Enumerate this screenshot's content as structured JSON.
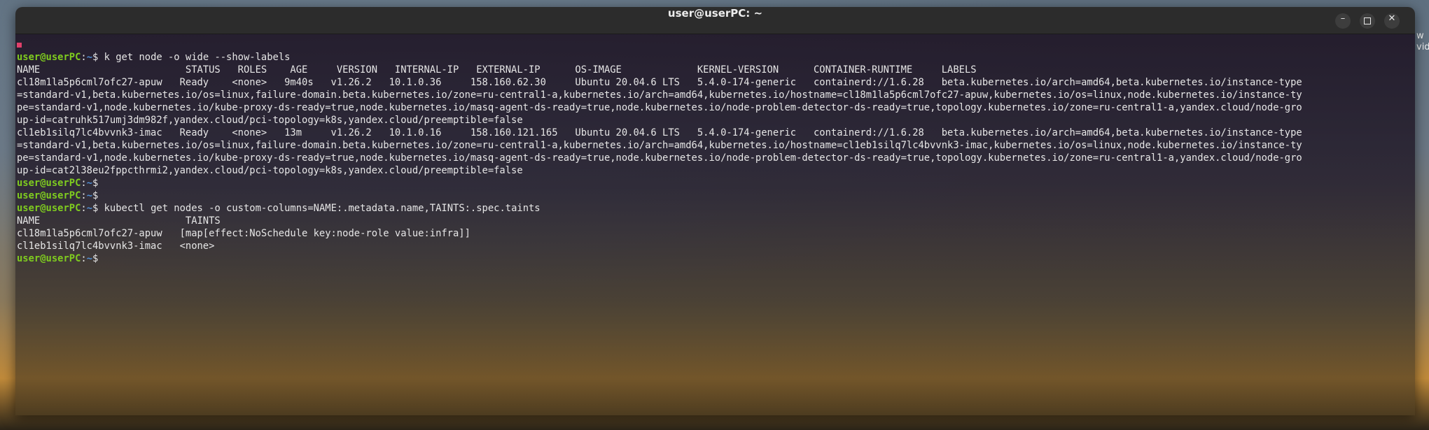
{
  "desktop": {
    "edge_text": "w\nvid"
  },
  "window": {
    "title": "user@userPC: ~",
    "minimize_label": "–",
    "close_label": "✕"
  },
  "prompt": {
    "user": "user@userPC",
    "path": "~",
    "colon": ":",
    "suffix": "$ "
  },
  "terminal": {
    "lines": [
      {
        "type": "cmd",
        "text": "k get node -o wide --show-labels"
      },
      {
        "type": "out",
        "text": "NAME                         STATUS   ROLES    AGE     VERSION   INTERNAL-IP   EXTERNAL-IP      OS-IMAGE             KERNEL-VERSION      CONTAINER-RUNTIME     LABELS"
      },
      {
        "type": "out",
        "text": "cl18m1la5p6cml7ofc27-apuw   Ready    <none>   9m40s   v1.26.2   10.1.0.36     158.160.62.30     Ubuntu 20.04.6 LTS   5.4.0-174-generic   containerd://1.6.28   beta.kubernetes.io/arch=amd64,beta.kubernetes.io/instance-type"
      },
      {
        "type": "out",
        "text": "=standard-v1,beta.kubernetes.io/os=linux,failure-domain.beta.kubernetes.io/zone=ru-central1-a,kubernetes.io/arch=amd64,kubernetes.io/hostname=cl18m1la5p6cml7ofc27-apuw,kubernetes.io/os=linux,node.kubernetes.io/instance-ty"
      },
      {
        "type": "out",
        "text": "pe=standard-v1,node.kubernetes.io/kube-proxy-ds-ready=true,node.kubernetes.io/masq-agent-ds-ready=true,node.kubernetes.io/node-problem-detector-ds-ready=true,topology.kubernetes.io/zone=ru-central1-a,yandex.cloud/node-gro"
      },
      {
        "type": "out",
        "text": "up-id=catruhk517umj3dm982f,yandex.cloud/pci-topology=k8s,yandex.cloud/preemptible=false"
      },
      {
        "type": "out",
        "text": "cl1eb1silq7lc4bvvnk3-imac   Ready    <none>   13m     v1.26.2   10.1.0.16     158.160.121.165   Ubuntu 20.04.6 LTS   5.4.0-174-generic   containerd://1.6.28   beta.kubernetes.io/arch=amd64,beta.kubernetes.io/instance-type"
      },
      {
        "type": "out",
        "text": "=standard-v1,beta.kubernetes.io/os=linux,failure-domain.beta.kubernetes.io/zone=ru-central1-a,kubernetes.io/arch=amd64,kubernetes.io/hostname=cl1eb1silq7lc4bvvnk3-imac,kubernetes.io/os=linux,node.kubernetes.io/instance-ty"
      },
      {
        "type": "out",
        "text": "pe=standard-v1,node.kubernetes.io/kube-proxy-ds-ready=true,node.kubernetes.io/masq-agent-ds-ready=true,node.kubernetes.io/node-problem-detector-ds-ready=true,topology.kubernetes.io/zone=ru-central1-a,yandex.cloud/node-gro"
      },
      {
        "type": "out",
        "text": "up-id=cat2l38eu2fppcthrmi2,yandex.cloud/pci-topology=k8s,yandex.cloud/preemptible=false"
      },
      {
        "type": "cmd",
        "text": ""
      },
      {
        "type": "cmd",
        "text": ""
      },
      {
        "type": "cmd",
        "text": "kubectl get nodes -o custom-columns=NAME:.metadata.name,TAINTS:.spec.taints"
      },
      {
        "type": "out",
        "text": "NAME                         TAINTS"
      },
      {
        "type": "out",
        "text": "cl18m1la5p6cml7ofc27-apuw   [map[effect:NoSchedule key:node-role value:infra]]"
      },
      {
        "type": "out",
        "text": "cl1eb1silq7lc4bvvnk3-imac   <none>"
      },
      {
        "type": "cmd",
        "text": ""
      }
    ]
  },
  "colors": {
    "prompt_user": "#7fcc1f",
    "prompt_path": "#4f8fd6",
    "text": "#e6e6e6",
    "titlebar": "#2c2c2c"
  }
}
